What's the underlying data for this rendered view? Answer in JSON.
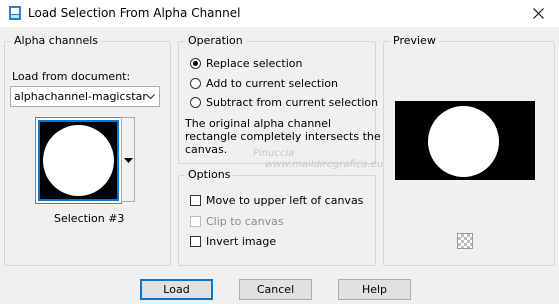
{
  "window": {
    "title": "Load Selection From Alpha Channel"
  },
  "alpha_channels": {
    "group_label": "Alpha channels",
    "load_from_label": "Load from document:",
    "document_value": "alphachannel-magicstar",
    "selection_name": "Selection #3"
  },
  "operation": {
    "group_label": "Operation",
    "options": [
      {
        "label": "Replace selection",
        "selected": true
      },
      {
        "label": "Add to current selection",
        "selected": false
      },
      {
        "label": "Subtract from current selection",
        "selected": false
      }
    ],
    "message_line1": "The original alpha channel",
    "message_line2": "rectangle completely intersects the",
    "message_line3": "canvas."
  },
  "options": {
    "group_label": "Options",
    "move_upper_left": "Move to upper left of canvas",
    "clip_to_canvas": "Clip to canvas",
    "invert_image": "Invert image"
  },
  "preview": {
    "group_label": "Preview"
  },
  "buttons": {
    "load": "Load",
    "cancel": "Cancel",
    "help": "Help"
  },
  "watermark": {
    "line1": "Pinuccia",
    "line2": "www.maildiregrafica.eu"
  },
  "colors": {
    "accent": "#0078d7",
    "dialog_bg": "#f0f0f0"
  }
}
